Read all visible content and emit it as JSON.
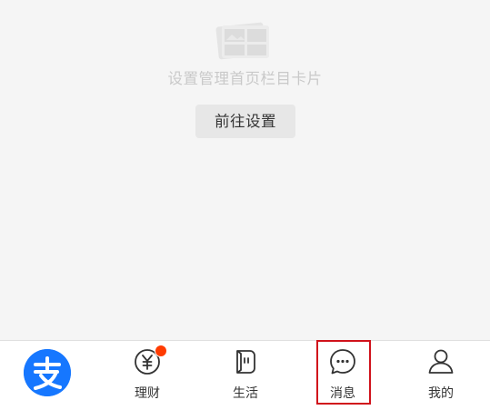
{
  "empty_state": {
    "message": "设置管理首页栏目卡片",
    "action_label": "前往设置",
    "illustration_icon": "cards-illustration-icon"
  },
  "tabbar": {
    "tabs": [
      {
        "label": "",
        "icon": "alipay-logo-icon",
        "active": true
      },
      {
        "label": "理财",
        "icon": "yuan-coin-icon",
        "badge": "dot"
      },
      {
        "label": "生活",
        "icon": "life-service-icon"
      },
      {
        "label": "消息",
        "icon": "chat-bubble-icon",
        "highlighted": true
      },
      {
        "label": "我的",
        "icon": "person-icon"
      }
    ]
  },
  "colors": {
    "brand": "#1677ff",
    "badge": "#ff3b00",
    "highlight": "#d0121b",
    "background": "#f5f5f5"
  }
}
